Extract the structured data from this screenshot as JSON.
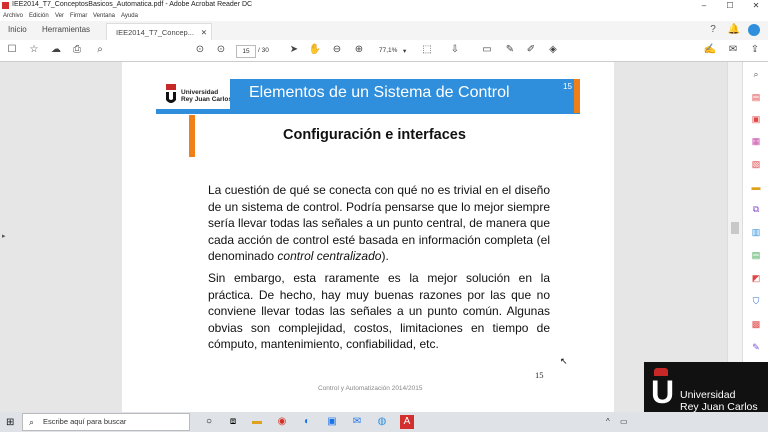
{
  "window": {
    "title": "IEE2014_T7_ConceptosBasicos_Automatica.pdf - Adobe Acrobat Reader DC",
    "controls": {
      "minimize": "–",
      "maximize": "☐",
      "close": "✕"
    }
  },
  "menu": [
    "Archivo",
    "Edición",
    "Ver",
    "Firmar",
    "Ventana",
    "Ayuda"
  ],
  "tabs": {
    "home": "Inicio",
    "tools": "Herramientas",
    "document": "IEE2014_T7_Concep...",
    "close": "✕"
  },
  "toolbar": {
    "current_page": "15",
    "total_pages": "/ 30",
    "zoom": "77,1%",
    "zoom_arrow": "▾"
  },
  "slide": {
    "university": [
      "Universidad",
      "Rey Juan Carlos"
    ],
    "title": "Elementos de un Sistema de Control",
    "slide_number": "15",
    "subtitle": "Configuración e interfaces",
    "paragraph1_before": "La cuestión de qué se conecta con qué no es trivial en el diseño de un sistema de control. Podría pensarse que lo mejor siempre sería llevar todas las señales a un punto central, de manera que cada acción de control esté basada en información completa (el denominado ",
    "paragraph1_em": "control centralizado",
    "paragraph1_after": ").",
    "paragraph2": "Sin embargo, esta raramente es la mejor solución en la práctica. De hecho, hay muy buenas razones por las que no conviene llevar todas las señales a un punto común. Algunas obvias son complejidad, costos, limitaciones en tiempo de cómputo, mantenimiento, confiabilidad, etc.",
    "footer": "Control y Automatización  2014/2015",
    "page_number": "15"
  },
  "overlay": {
    "logo_letter": "U",
    "line1": "Universidad",
    "line2": "Rey Juan Carlos"
  },
  "taskbar": {
    "start": "⊞",
    "search_icon": "⌕",
    "search_placeholder": "Escribe aquí para buscar"
  },
  "colors": {
    "banner": "#2f8fdc",
    "accent_orange": "#f07f1a",
    "urjc_red": "#c62828"
  }
}
